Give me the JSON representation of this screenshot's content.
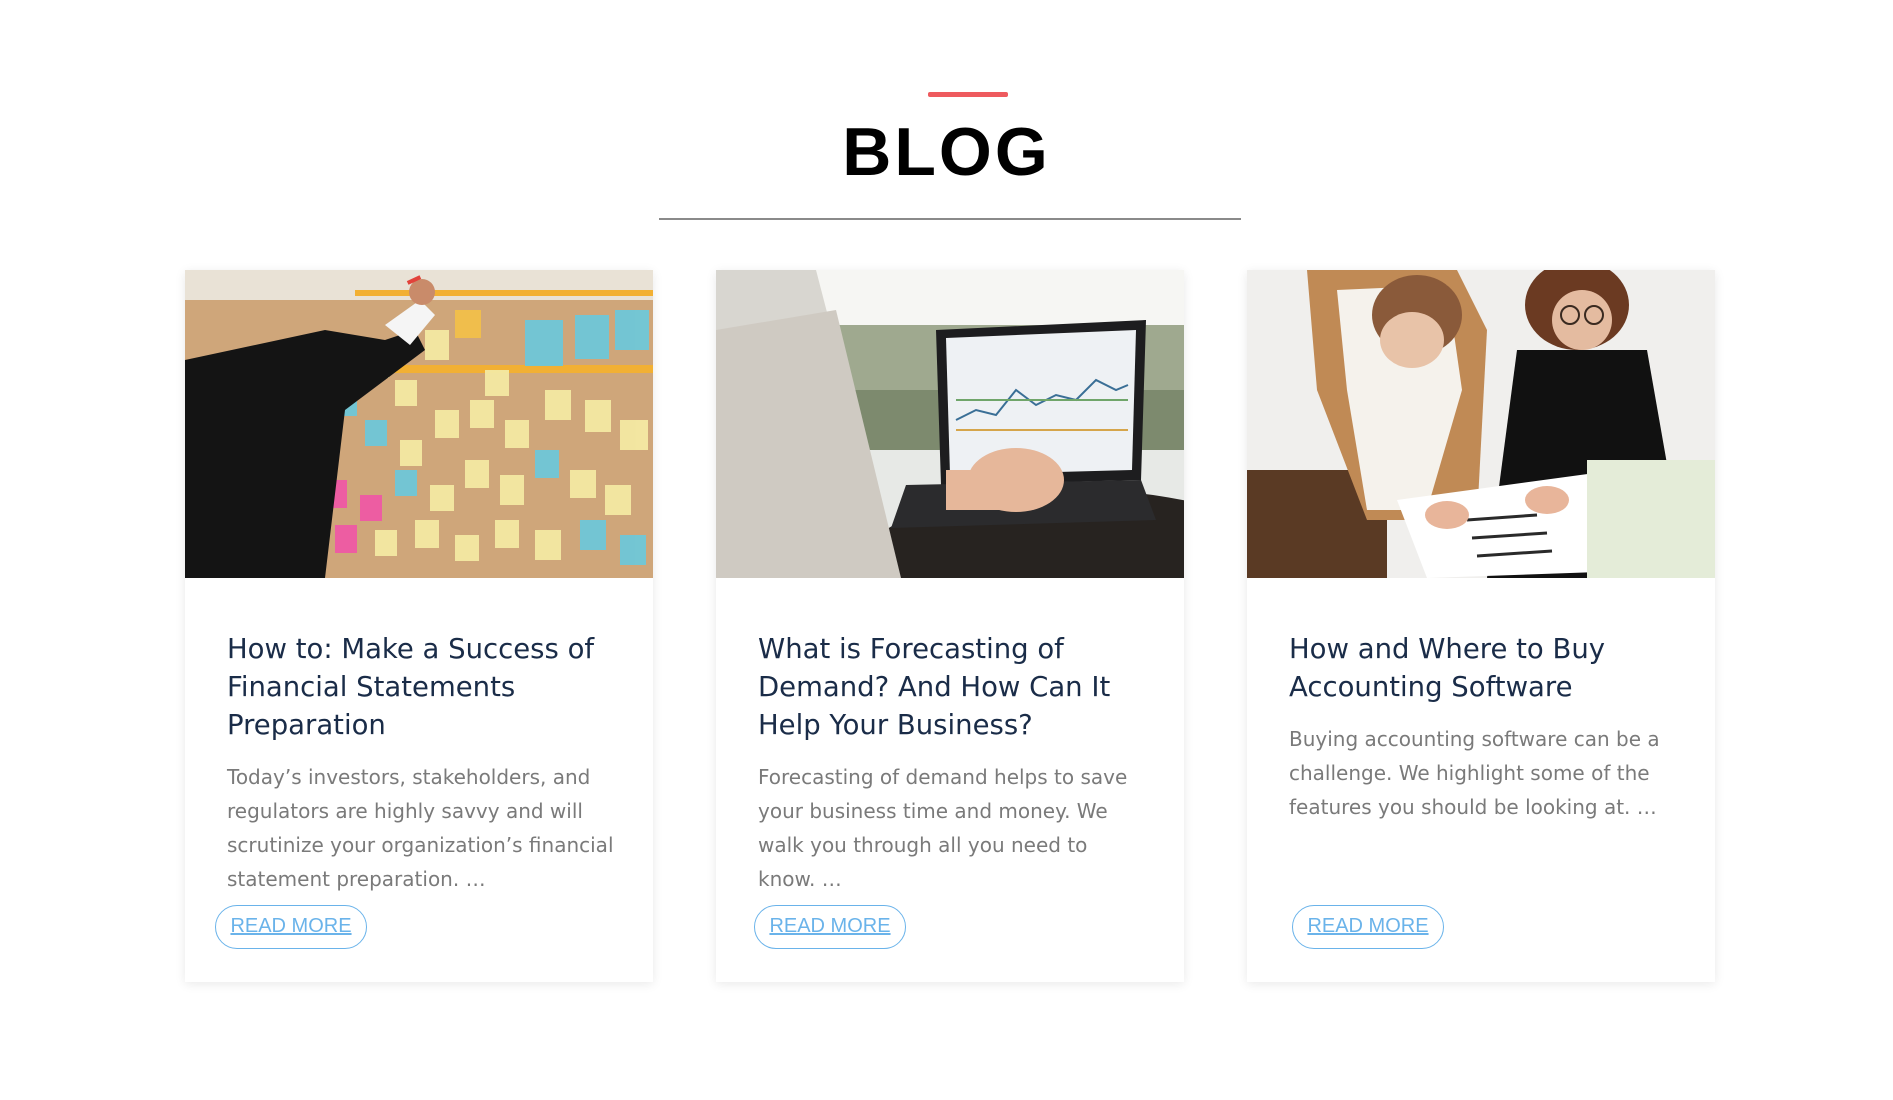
{
  "section": {
    "title": "BLOG",
    "accent_color": "#ee5a5e"
  },
  "posts": [
    {
      "image": "sticky-notes-planning-board-photo",
      "title": "How to: Make a Success of Financial Statements Preparation",
      "excerpt": "Today’s investors, stakeholders, and regulators are highly savvy and will scrutinize your organization’s financial statement preparation. …",
      "cta": "READ MORE"
    },
    {
      "image": "laptop-chart-photo",
      "title": "What is Forecasting of Demand? And How Can It Help Your Business?",
      "excerpt": "Forecasting of demand helps to save your business time and money. We walk you through all you need to know. …",
      "cta": "READ MORE"
    },
    {
      "image": "two-women-reviewing-documents-photo",
      "title": "How and Where to Buy Accounting Software",
      "excerpt": "Buying accounting software can be a challenge. We highlight some of the features you should be looking at. …",
      "cta": "READ MORE"
    }
  ],
  "colors": {
    "title_text": "#1a2c48",
    "excerpt_text": "#7a7a7a",
    "link": "#6ab3ea"
  }
}
